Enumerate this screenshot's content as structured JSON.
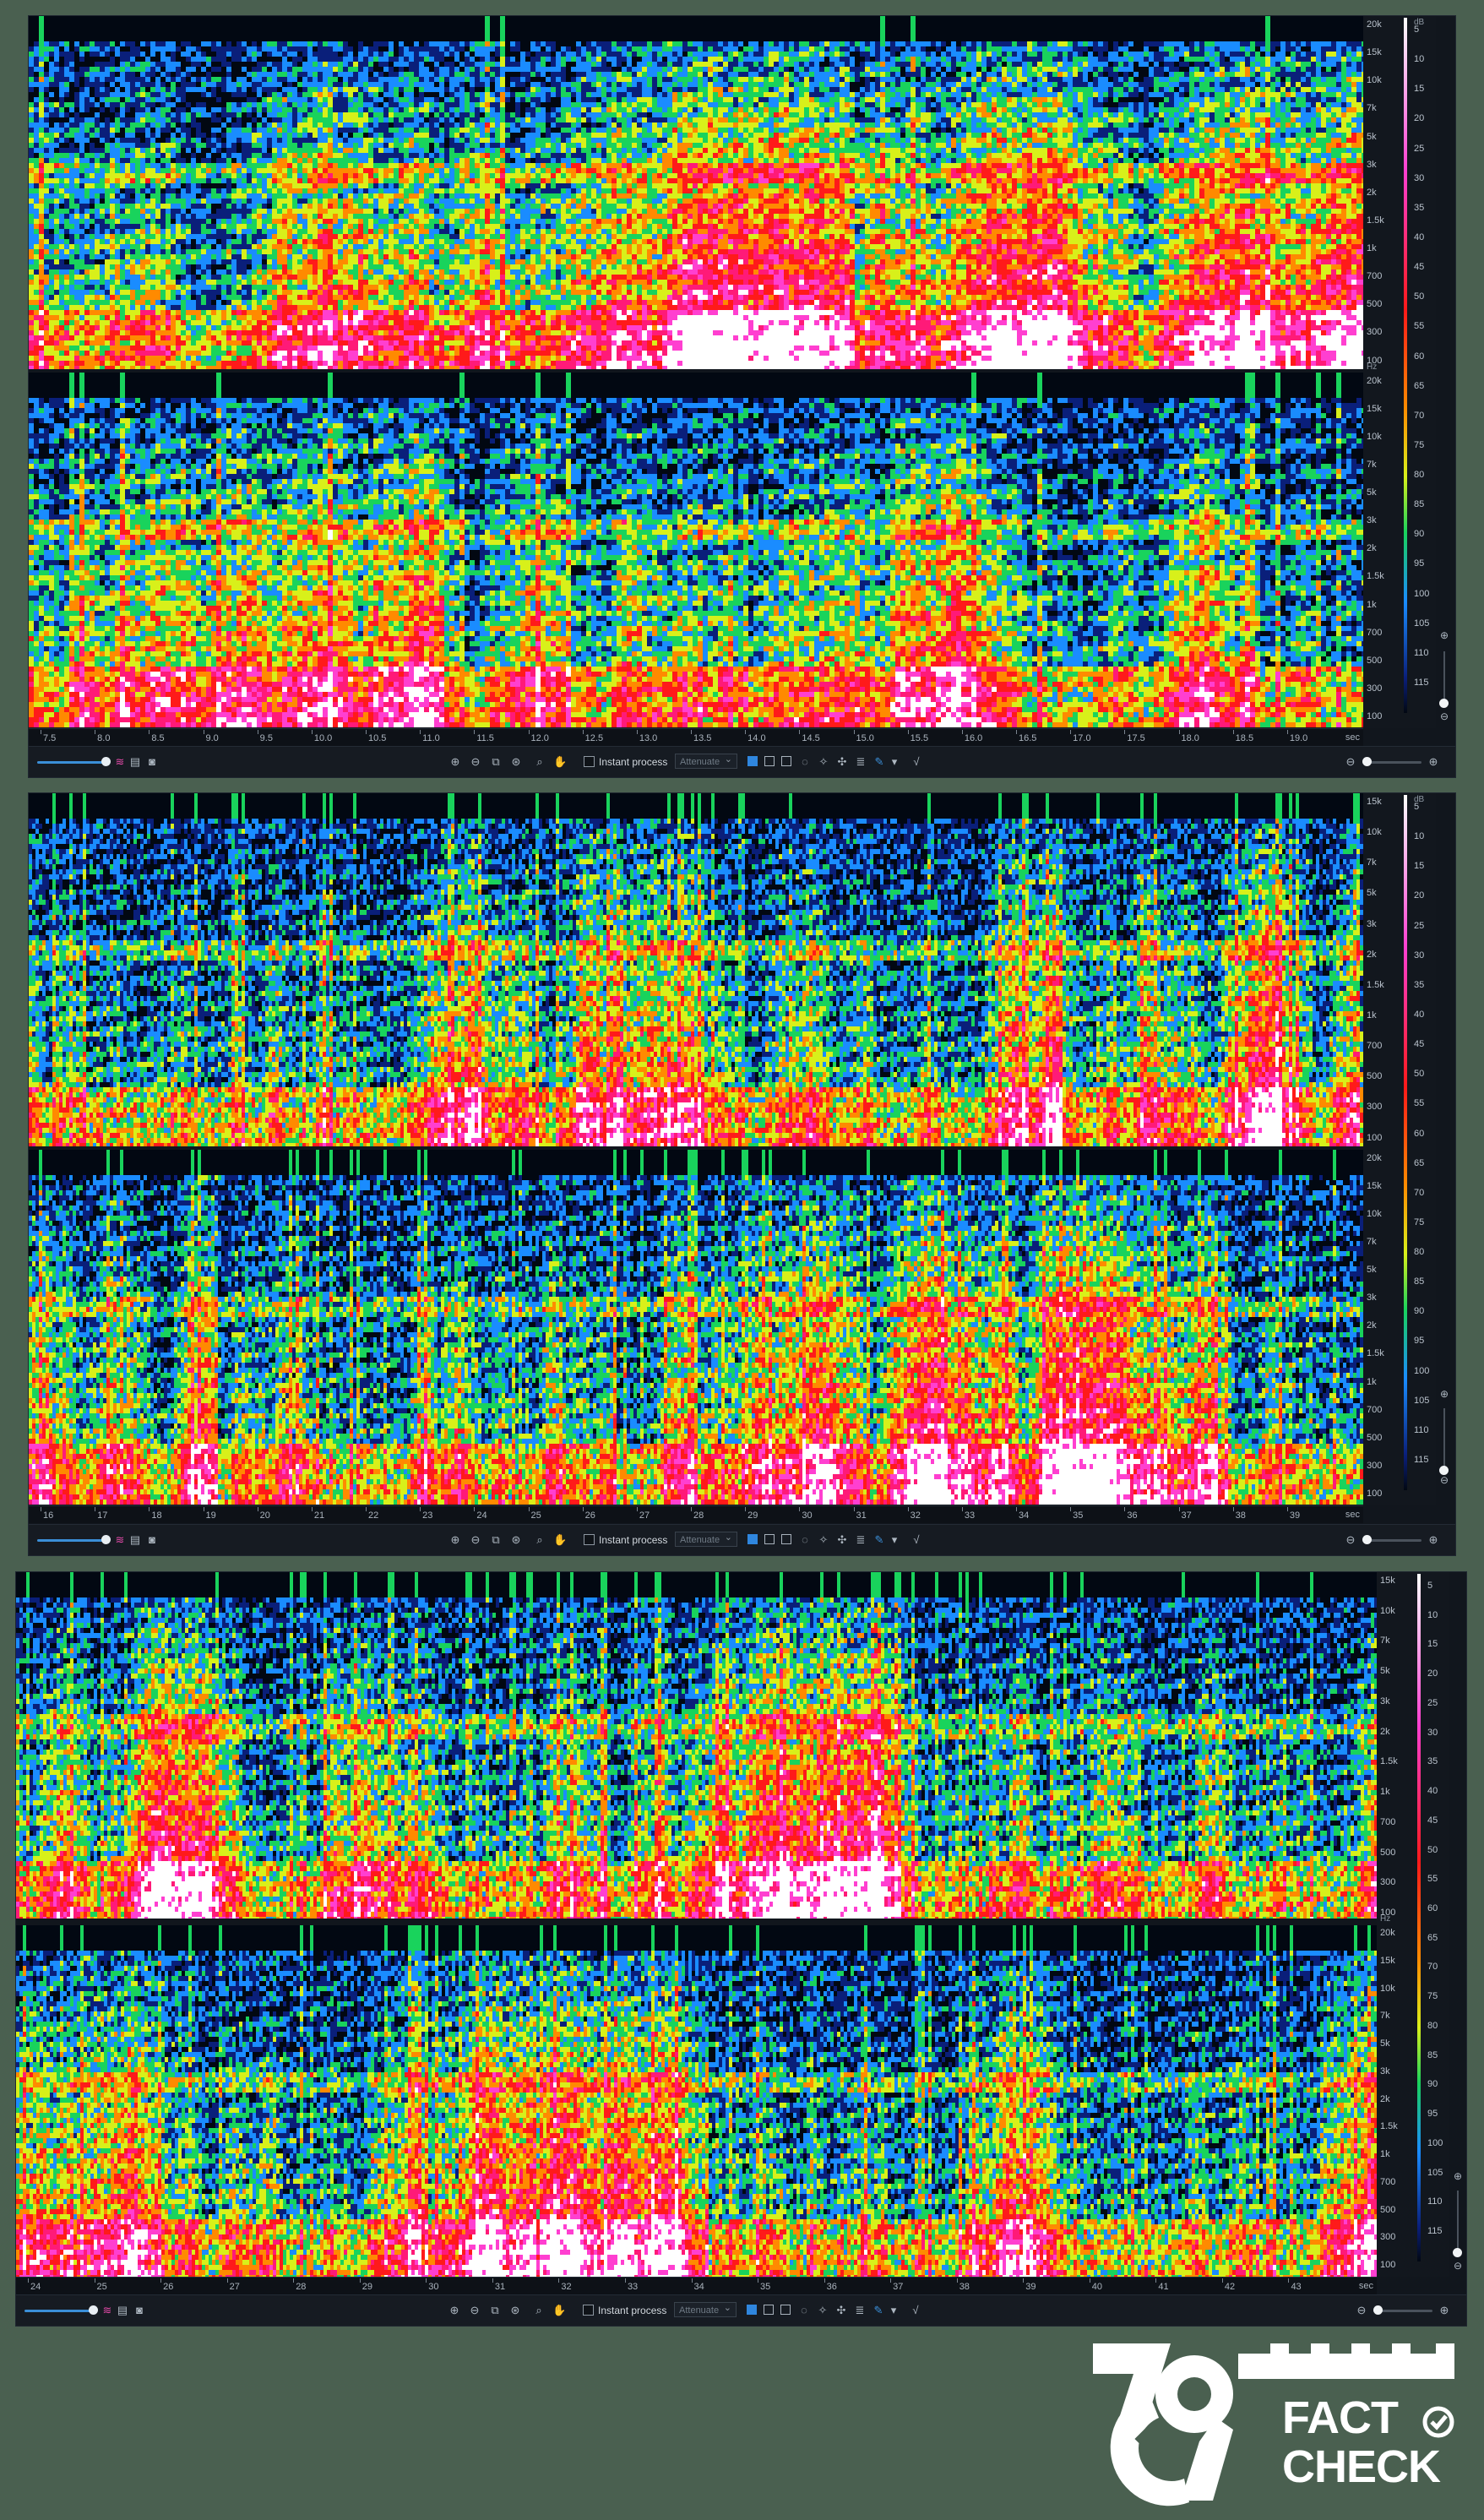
{
  "panels": [
    {
      "id": "panel-1",
      "db_unit": "dB",
      "hz_unit": "Hz",
      "hz_labels_top": [
        "20k",
        "15k",
        "10k",
        "7k",
        "5k",
        "3k",
        "2k",
        "1.5k",
        "1k",
        "700",
        "500",
        "300",
        "100"
      ],
      "hz_labels_bottom": [
        "20k",
        "15k",
        "10k",
        "7k",
        "5k",
        "3k",
        "2k",
        "1.5k",
        "1k",
        "700",
        "500",
        "300",
        "100"
      ],
      "db_labels": [
        "5",
        "10",
        "15",
        "20",
        "25",
        "30",
        "35",
        "40",
        "45",
        "50",
        "55",
        "60",
        "65",
        "70",
        "75",
        "80",
        "85",
        "90",
        "95",
        "100",
        "105",
        "110",
        "115"
      ],
      "time_labels": [
        "7.5",
        "8.0",
        "8.5",
        "9.0",
        "9.5",
        "10.0",
        "10.5",
        "11.0",
        "11.5",
        "12.0",
        "12.5",
        "13.0",
        "13.5",
        "14.0",
        "14.5",
        "15.0",
        "15.5",
        "16.0",
        "16.5",
        "17.0",
        "17.5",
        "18.0",
        "18.5",
        "19.0"
      ],
      "time_unit": "sec",
      "toolbar": {
        "instant_process_label": "Instant process",
        "mode_value": "Attenuate"
      }
    },
    {
      "id": "panel-2",
      "db_unit": "dB",
      "hz_unit": "",
      "hz_labels_top": [
        "15k",
        "10k",
        "7k",
        "5k",
        "3k",
        "2k",
        "1.5k",
        "1k",
        "700",
        "500",
        "300",
        "100"
      ],
      "hz_labels_bottom": [
        "20k",
        "15k",
        "10k",
        "7k",
        "5k",
        "3k",
        "2k",
        "1.5k",
        "1k",
        "700",
        "500",
        "300",
        "100"
      ],
      "db_labels": [
        "5",
        "10",
        "15",
        "20",
        "25",
        "30",
        "35",
        "40",
        "45",
        "50",
        "55",
        "60",
        "65",
        "70",
        "75",
        "80",
        "85",
        "90",
        "95",
        "100",
        "105",
        "110",
        "115"
      ],
      "time_labels": [
        "16",
        "17",
        "18",
        "19",
        "20",
        "21",
        "22",
        "23",
        "24",
        "25",
        "26",
        "27",
        "28",
        "29",
        "30",
        "31",
        "32",
        "33",
        "34",
        "35",
        "36",
        "37",
        "38",
        "39"
      ],
      "time_unit": "sec",
      "toolbar": {
        "instant_process_label": "Instant process",
        "mode_value": "Attenuate"
      }
    },
    {
      "id": "panel-3",
      "db_unit": "",
      "hz_unit": "Hz",
      "hz_labels_top": [
        "15k",
        "10k",
        "7k",
        "5k",
        "3k",
        "2k",
        "1.5k",
        "1k",
        "700",
        "500",
        "300",
        "100"
      ],
      "hz_labels_bottom": [
        "20k",
        "15k",
        "10k",
        "7k",
        "5k",
        "3k",
        "2k",
        "1.5k",
        "1k",
        "700",
        "500",
        "300",
        "100"
      ],
      "db_labels": [
        "5",
        "10",
        "15",
        "20",
        "25",
        "30",
        "35",
        "40",
        "45",
        "50",
        "55",
        "60",
        "65",
        "70",
        "75",
        "80",
        "85",
        "90",
        "95",
        "100",
        "105",
        "110",
        "115"
      ],
      "time_labels": [
        "24",
        "25",
        "26",
        "27",
        "28",
        "29",
        "30",
        "31",
        "32",
        "33",
        "34",
        "35",
        "36",
        "37",
        "38",
        "39",
        "40",
        "41",
        "42",
        "43"
      ],
      "time_unit": "sec",
      "toolbar": {
        "instant_process_label": "Instant process",
        "mode_value": "Attenuate"
      }
    }
  ],
  "colors": {
    "page_bg": "#4a6050",
    "spectrum": [
      "#020812",
      "#0a1f7a",
      "#1a8cff",
      "#19d35c",
      "#d8f01a",
      "#ff8a00",
      "#ff1a1a",
      "#ff1a78",
      "#ff3fd0",
      "#ffffff"
    ]
  },
  "icons": [
    "zoom-in-icon",
    "zoom-out-icon",
    "zoom-selection-icon",
    "zoom-fit-icon",
    "magnifier-icon",
    "hand-icon",
    "time-selection-icon",
    "frequency-selection-icon",
    "time-frequency-selection-icon",
    "lasso-icon",
    "magic-wand-icon",
    "harmonic-selection-icon",
    "brush-icon",
    "instant-process-check-icon"
  ],
  "logo": {
    "brand": "79 FACT CHECK",
    "line1": "FACT",
    "line2": "CHECK"
  }
}
